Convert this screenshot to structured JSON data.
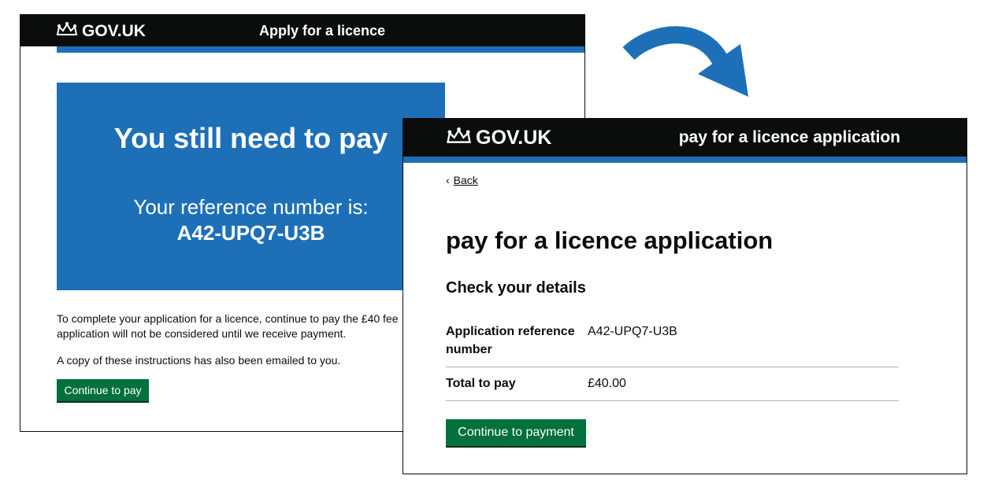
{
  "brand": "GOV.UK",
  "colors": {
    "header_bg": "#0b0c0c",
    "brand_blue": "#1d70b8",
    "button_green": "#00703c"
  },
  "icons": {
    "logo": "crown-icon",
    "back": "chevron-left-icon",
    "flow": "curved-arrow-icon"
  },
  "screen1": {
    "service_name": "Apply for a licence",
    "panel_title": "You still need to pay",
    "ref_label": "Your reference number is:",
    "ref_number": "A42-UPQ7-U3B",
    "para1_line1": "To complete your application for a licence, continue to pay the £40 fee",
    "para1_line2": "application will not be considered until we receive payment.",
    "para2": "A copy of these instructions has also been emailed to you.",
    "button_label": "Continue to pay"
  },
  "screen2": {
    "service_name": "pay for a licence application",
    "back_label": "Back",
    "heading": "pay for a licence application",
    "subheading": "Check your details",
    "rows": [
      {
        "key": "Application reference number",
        "value": "A42-UPQ7-U3B"
      },
      {
        "key": "Total to pay",
        "value": "£40.00"
      }
    ],
    "button_label": "Continue to payment"
  }
}
